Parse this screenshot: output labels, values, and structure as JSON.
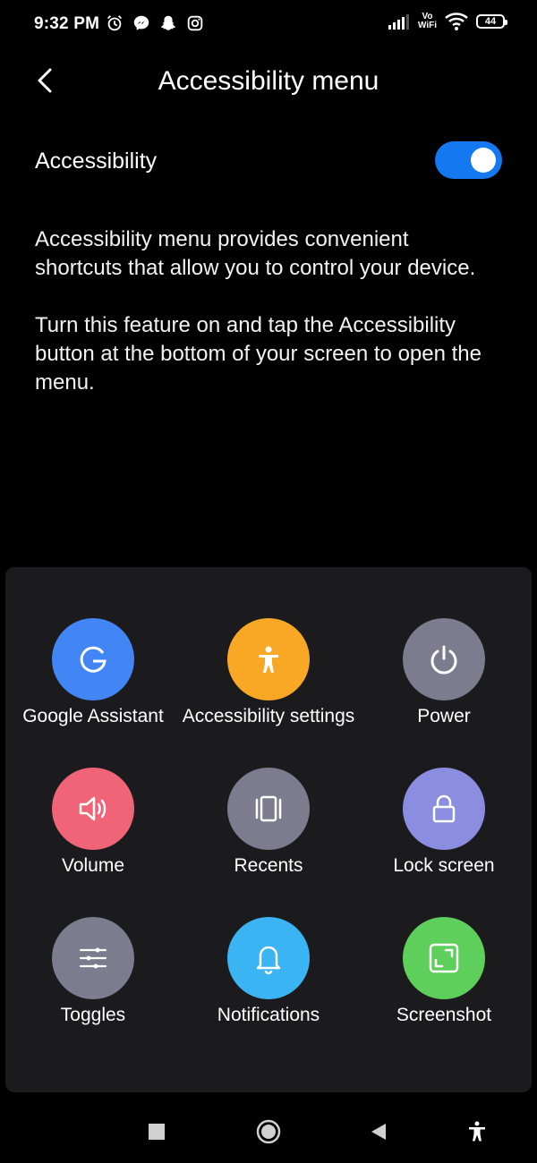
{
  "status_bar": {
    "time": "9:32 PM",
    "icons_left": [
      "alarm-icon",
      "messenger-icon",
      "snapchat-icon",
      "instagram-icon"
    ],
    "network_label_top": "Vo",
    "network_label_bottom": "WiFi",
    "battery": "44"
  },
  "header": {
    "title": "Accessibility menu",
    "back_icon": "chevron-left-icon"
  },
  "toggle": {
    "label": "Accessibility",
    "state": "on",
    "color": "#1478f0"
  },
  "description": {
    "paragraph1": "Accessibility menu provides convenient shortcuts that allow you to control your device.",
    "paragraph2": "Turn this feature on and tap the Accessibility button at the bottom of your screen to open the menu."
  },
  "menu": {
    "items": [
      {
        "label": "Google Assistant",
        "icon": "google-g-icon",
        "color": "#4285f4"
      },
      {
        "label": "Accessibility settings",
        "icon": "accessibility-person-icon",
        "color": "#f9a825"
      },
      {
        "label": "Power",
        "icon": "power-icon",
        "color": "#7d7b8e"
      },
      {
        "label": "Volume",
        "icon": "volume-icon",
        "color": "#f06478"
      },
      {
        "label": "Recents",
        "icon": "recents-icon",
        "color": "#7d7b8e"
      },
      {
        "label": "Lock screen",
        "icon": "lock-icon",
        "color": "#8b8de0"
      },
      {
        "label": "Toggles",
        "icon": "sliders-icon",
        "color": "#7d7b8e"
      },
      {
        "label": "Notifications",
        "icon": "bell-icon",
        "color": "#3ab4f2"
      },
      {
        "label": "Screenshot",
        "icon": "screenshot-icon",
        "color": "#5fcf5b"
      }
    ]
  },
  "nav_bar": {
    "buttons": [
      "square-icon",
      "home-circle-icon",
      "back-triangle-icon",
      "accessibility-icon"
    ]
  }
}
